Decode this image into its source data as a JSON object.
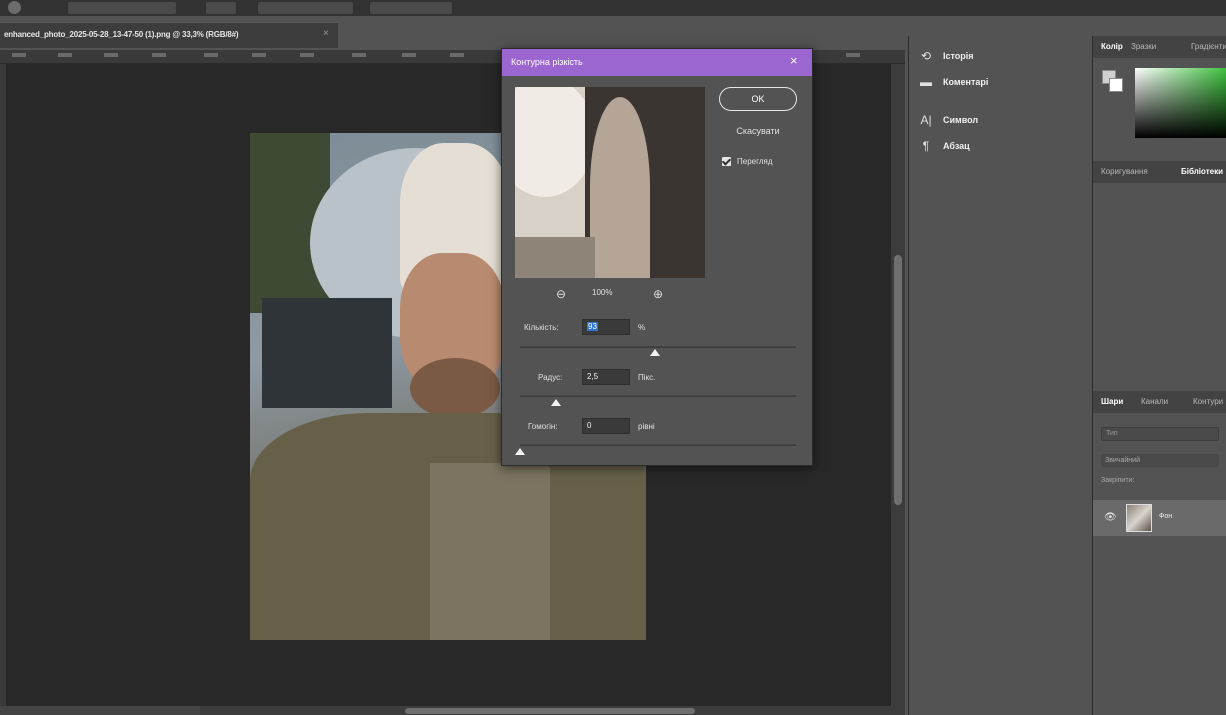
{
  "document": {
    "tab_title": "enhanced_photo_2025-05-28_13-47-50 (1).png @ 33,3% (RGB/8#)"
  },
  "dialog": {
    "title": "Контурна різкість",
    "ok_label": "OK",
    "cancel_label": "Скасувати",
    "preview_label": "Перегляд",
    "preview_checked": true,
    "zoom_value": "100%",
    "amount": {
      "label": "Кількість:",
      "value": "93",
      "unit": "%",
      "slider_fraction": 0.49
    },
    "radius": {
      "label": "Радус:",
      "value": "2,5",
      "unit": "Пікс.",
      "slider_fraction": 0.13
    },
    "threshold": {
      "label": "Гомогін:",
      "value": "0",
      "unit": "рівні",
      "slider_fraction": 0.0
    }
  },
  "panels_left": {
    "items": [
      {
        "icon": "history-icon",
        "label": "Історія"
      },
      {
        "icon": "comment-icon",
        "label": "Коментарі"
      },
      {
        "icon": "character-icon",
        "label": "Символ"
      },
      {
        "icon": "paragraph-icon",
        "label": "Абзац"
      }
    ]
  },
  "panels_right": {
    "color_tabs": [
      "Колір",
      "Зразки",
      "Градієнти"
    ],
    "mid_tabs": [
      "Коригування",
      "Бібліотеки"
    ],
    "layer_tabs": [
      "Шари",
      "Канали",
      "Контури"
    ],
    "layer_search_placeholder": "Тип",
    "layer_blend_mode": "Звичайний",
    "layer_lock_label": "Закріпити:",
    "layer_name": "Фон"
  },
  "colors": {
    "dialog_title_bar": "#9b66cf",
    "selection": "#2f74d0"
  }
}
